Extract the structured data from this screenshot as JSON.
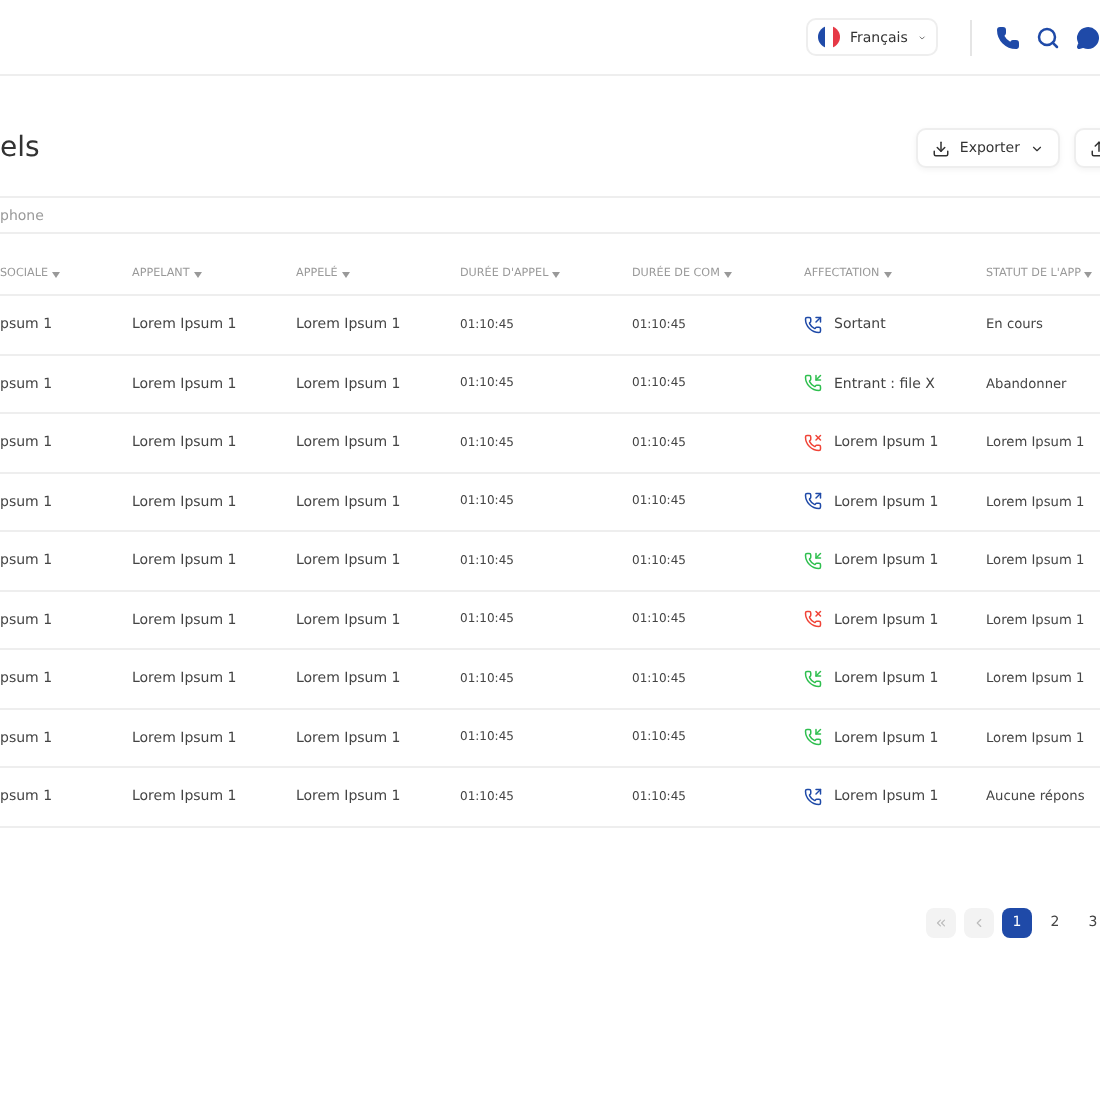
{
  "header": {
    "language": "Français"
  },
  "page": {
    "title": "els",
    "export_button": "Exporter"
  },
  "search": {
    "placeholder": "phone"
  },
  "table": {
    "columns": [
      "SOCIALE",
      "APPELANT",
      "APPELÉ",
      "DURÉE D'APPEL",
      "DURÉE DE COM",
      "AFFECTATION",
      "STATUT DE L'APP"
    ],
    "rows": [
      {
        "cells": [
          "psum 1",
          "Lorem Ipsum 1",
          "Lorem Ipsum 1",
          "01:10:45",
          "01:10:45"
        ],
        "affectation": {
          "kind": "outgoing",
          "color": "#1f4aa8",
          "label": "Sortant"
        },
        "status": "En cours"
      },
      {
        "cells": [
          "psum 1",
          "Lorem Ipsum 1",
          "Lorem Ipsum 1",
          "01:10:45",
          "01:10:45"
        ],
        "affectation": {
          "kind": "incoming",
          "color": "#2fbf4f",
          "label": "Entrant : file X"
        },
        "status": "Abandonner"
      },
      {
        "cells": [
          "psum 1",
          "Lorem Ipsum 1",
          "Lorem Ipsum 1",
          "01:10:45",
          "01:10:45"
        ],
        "affectation": {
          "kind": "missed",
          "color": "#f04438",
          "label": "Lorem Ipsum 1"
        },
        "status": "Lorem Ipsum 1"
      },
      {
        "cells": [
          "psum 1",
          "Lorem Ipsum 1",
          "Lorem Ipsum 1",
          "01:10:45",
          "01:10:45"
        ],
        "affectation": {
          "kind": "outgoing",
          "color": "#1f4aa8",
          "label": "Lorem Ipsum 1"
        },
        "status": "Lorem Ipsum 1"
      },
      {
        "cells": [
          "psum 1",
          "Lorem Ipsum 1",
          "Lorem Ipsum 1",
          "01:10:45",
          "01:10:45"
        ],
        "affectation": {
          "kind": "incoming",
          "color": "#2fbf4f",
          "label": "Lorem Ipsum 1"
        },
        "status": "Lorem Ipsum 1"
      },
      {
        "cells": [
          "psum 1",
          "Lorem Ipsum 1",
          "Lorem Ipsum 1",
          "01:10:45",
          "01:10:45"
        ],
        "affectation": {
          "kind": "missed",
          "color": "#f04438",
          "label": "Lorem Ipsum 1"
        },
        "status": "Lorem Ipsum 1"
      },
      {
        "cells": [
          "psum 1",
          "Lorem Ipsum 1",
          "Lorem Ipsum 1",
          "01:10:45",
          "01:10:45"
        ],
        "affectation": {
          "kind": "incoming",
          "color": "#2fbf4f",
          "label": "Lorem Ipsum 1"
        },
        "status": "Lorem Ipsum 1"
      },
      {
        "cells": [
          "psum 1",
          "Lorem Ipsum 1",
          "Lorem Ipsum 1",
          "01:10:45",
          "01:10:45"
        ],
        "affectation": {
          "kind": "incoming",
          "color": "#2fbf4f",
          "label": "Lorem Ipsum 1"
        },
        "status": "Lorem Ipsum 1"
      },
      {
        "cells": [
          "psum 1",
          "Lorem Ipsum 1",
          "Lorem Ipsum 1",
          "01:10:45",
          "01:10:45"
        ],
        "affectation": {
          "kind": "outgoing",
          "color": "#1f4aa8",
          "label": "Lorem Ipsum 1"
        },
        "status": "Aucune répons"
      }
    ]
  },
  "pagination": {
    "pages": [
      {
        "label": "1",
        "selected": true
      },
      {
        "label": "2",
        "selected": false
      },
      {
        "label": "3",
        "selected": false
      }
    ]
  }
}
